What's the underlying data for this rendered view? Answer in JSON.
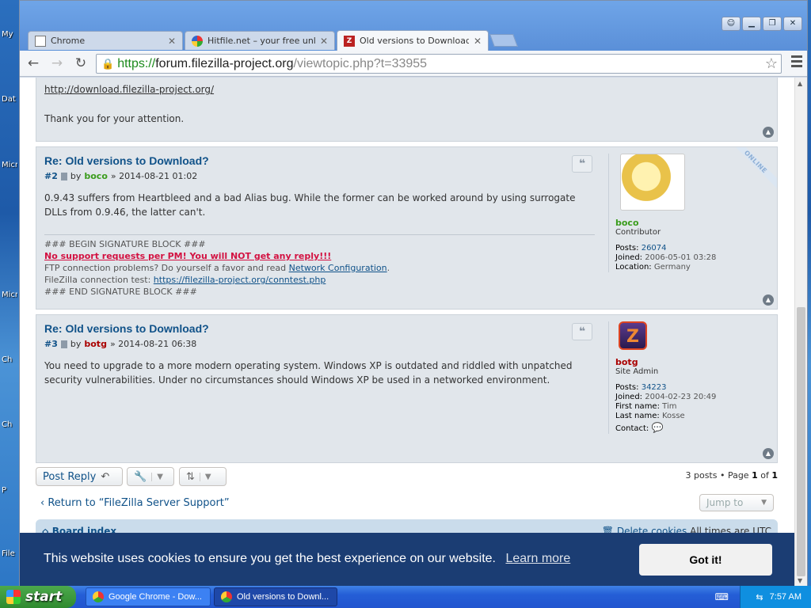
{
  "desktop": {
    "icons": [
      "My",
      "Dat",
      "Micr",
      "Micr",
      "Ch",
      "Ch",
      "P",
      "File"
    ]
  },
  "browser": {
    "tabs": [
      {
        "title": "Chrome",
        "icon": "document-icon"
      },
      {
        "title": "Hitfile.net – your free unlimi",
        "icon": "hitfile-icon"
      },
      {
        "title": "Old versions to Download? -",
        "icon": "filezilla-icon"
      }
    ],
    "window_buttons": [
      "user-icon",
      "minimize-icon",
      "restore-icon",
      "close-icon"
    ],
    "url": {
      "scheme": "https://",
      "host": "forum.filezilla-project.org",
      "path": "/viewtopic.php?t=33955"
    }
  },
  "first_post": {
    "link": "http://download.filezilla-project.org/",
    "closing": "Thank you for your attention."
  },
  "posts": [
    {
      "title": "Re: Old versions to Download?",
      "number": "#2",
      "by": "by",
      "author": "boco",
      "datetime": "» 2014-08-21 01:02",
      "body": "0.9.43 suffers from Heartbleed and a bad Alias bug. While the former can be worked around by using surrogate DLLs from 0.9.46, the latter can't.",
      "online": "ONLINE",
      "signature": {
        "begin": "### BEGIN SIGNATURE BLOCK ###",
        "warning": "No support requests per PM! You will NOT get any reply!!!",
        "ftp_prefix": "FTP connection problems? Do yourself a favor and read",
        "ftp_link": "Network Configuration",
        "ftp_suffix": ".",
        "test_prefix": "FileZilla connection test:",
        "test_link": "https://filezilla-project.org/conntest.php",
        "end": "### END SIGNATURE BLOCK ###"
      },
      "profile": {
        "name": "boco",
        "rank": "Contributor",
        "posts_label": "Posts:",
        "posts": "26074",
        "joined_label": "Joined:",
        "joined": "2006-05-01 03:28",
        "location_label": "Location:",
        "location": "Germany"
      }
    },
    {
      "title": "Re: Old versions to Download?",
      "number": "#3",
      "by": "by",
      "author": "botg",
      "datetime": "» 2014-08-21 06:38",
      "body": "You need to upgrade to a more modern operating system. Windows XP is outdated and riddled with unpatched security vulnerabilities. Under no circumstances should Windows XP be used in a networked environment.",
      "profile": {
        "name": "botg",
        "rank": "Site Admin",
        "posts_label": "Posts:",
        "posts": "34223",
        "joined_label": "Joined:",
        "joined": "2004-02-23 20:49",
        "first_label": "First name:",
        "first": "Tim",
        "last_label": "Last name:",
        "last": "Kosse",
        "contact_label": "Contact:"
      }
    }
  ],
  "actions": {
    "post_reply": "Post Reply",
    "pagination_prefix": "3 posts • Page",
    "page": "1",
    "of": "of",
    "total_pages": "1",
    "return_link": "Return to “FileZilla Server Support”",
    "jump_to": "Jump to"
  },
  "footer": {
    "board_index": "Board index",
    "delete_cookies": "Delete cookies",
    "times": "All times are UTC"
  },
  "cookie": {
    "message": "This website uses cookies to ensure you get the best experience on our website.",
    "learn_more": "Learn more",
    "accept": "Got it!"
  },
  "taskbar": {
    "start": "start",
    "tasks": [
      "Google Chrome - Dow...",
      "Old versions to Downl..."
    ],
    "time": "7:57 AM"
  }
}
